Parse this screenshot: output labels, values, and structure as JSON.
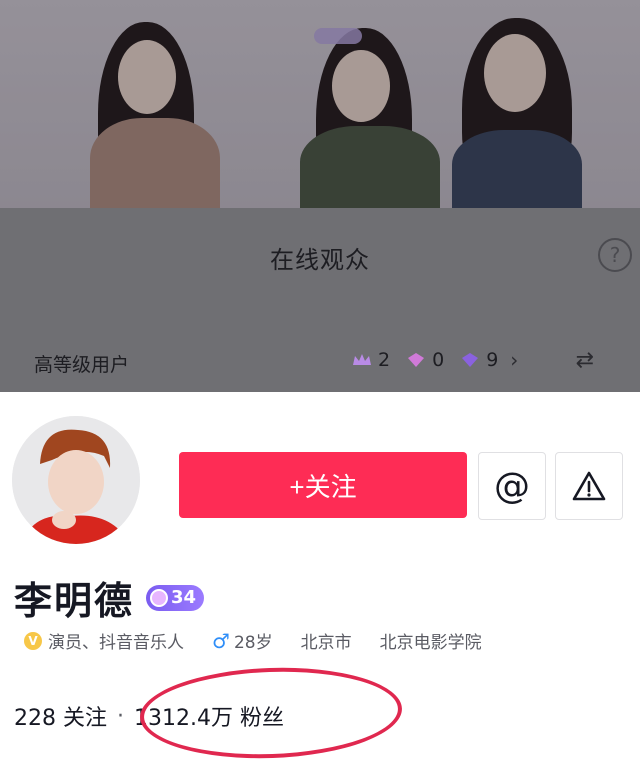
{
  "overlay": {
    "panel_title": "在线观众",
    "help_icon": "question-circle-icon",
    "section_label": "高等级用户",
    "badges": [
      {
        "icon": "crown-icon",
        "count": "2",
        "color": "#b98be6"
      },
      {
        "icon": "gem-pink-icon",
        "count": "0",
        "color": "#d07ad8"
      },
      {
        "icon": "gem-purple-icon",
        "count": "9",
        "color": "#8a62df"
      }
    ],
    "chevron_icon": "chevron-right-icon",
    "swap_icon": "swap-icon"
  },
  "profile": {
    "follow_label": "+关注",
    "at_label": "@",
    "report_icon": "warning-triangle-icon",
    "name": "李明德",
    "level": "34",
    "verified_icon": "v-badge-icon",
    "occupation": "演员、抖音音乐人",
    "gender_icon": "male-icon",
    "age": "28岁",
    "city": "北京市",
    "school": "北京电影学院",
    "following_count": "228",
    "following_label": "关注",
    "separator": "·",
    "followers_count": "1312.4万",
    "followers_label": "粉丝"
  },
  "colors": {
    "accent": "#fe2c55",
    "annotation": "#e0284f"
  }
}
